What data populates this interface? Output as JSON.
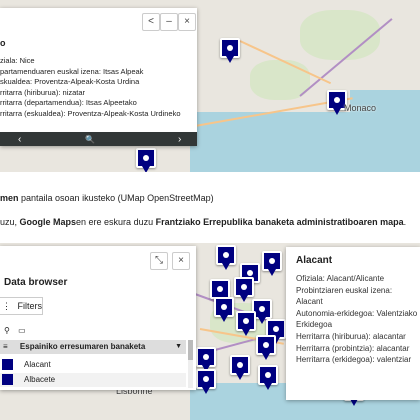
{
  "top_map": {
    "cities": [
      "Monaco"
    ],
    "popup": {
      "heading": "o",
      "props": [
        "ziala: Nice",
        "partamenduaren euskal izena: Itsas Alpeak",
        "skualdea: Proventza-Alpeak-Kosta Urdina",
        "rritarra (hiriburua): nizatar",
        "rritarra (departamendua): Itsas Alpeetako",
        "rritarra (eskualdea): Proventza-Alpeak-Kosta Urdineko"
      ],
      "prev_icon": "‹",
      "next_icon": "›",
      "zoom_icon": "🔍",
      "prev_label": "<",
      "close_label": "×"
    }
  },
  "caption": {
    "strong": "men",
    "rest": " pantaila osoan ikusteko  (UMap OpenStreetMap)"
  },
  "sentence": {
    "pre": "uzu, ",
    "b1": "Google Maps",
    "mid": "en ere eskura duzu ",
    "b2": "Frantziako Errepublika banaketa administratiboaren mapa",
    "post": "."
  },
  "bottom_map": {
    "cities": [
      "Lisbonne"
    ],
    "data_browser": {
      "title": "Data browser",
      "filters_label": "Filters",
      "layer_name": "Espainiko erresumaren banaketa",
      "rows": [
        "Alacant",
        "Albacete"
      ]
    },
    "tooltip": {
      "title": "Alacant",
      "lines": [
        "Ofiziala: Alacant/Alicante",
        "Probintziaren euskal izena:",
        "Alacant",
        "Autonomia-erkidegoa: Valentziako",
        "Erkidegoa",
        "Herritarra (hiriburua): alacantar",
        "Herritarra (probintzia): alacantar",
        "Herritarra (erkidegoa): valentziar"
      ]
    }
  }
}
